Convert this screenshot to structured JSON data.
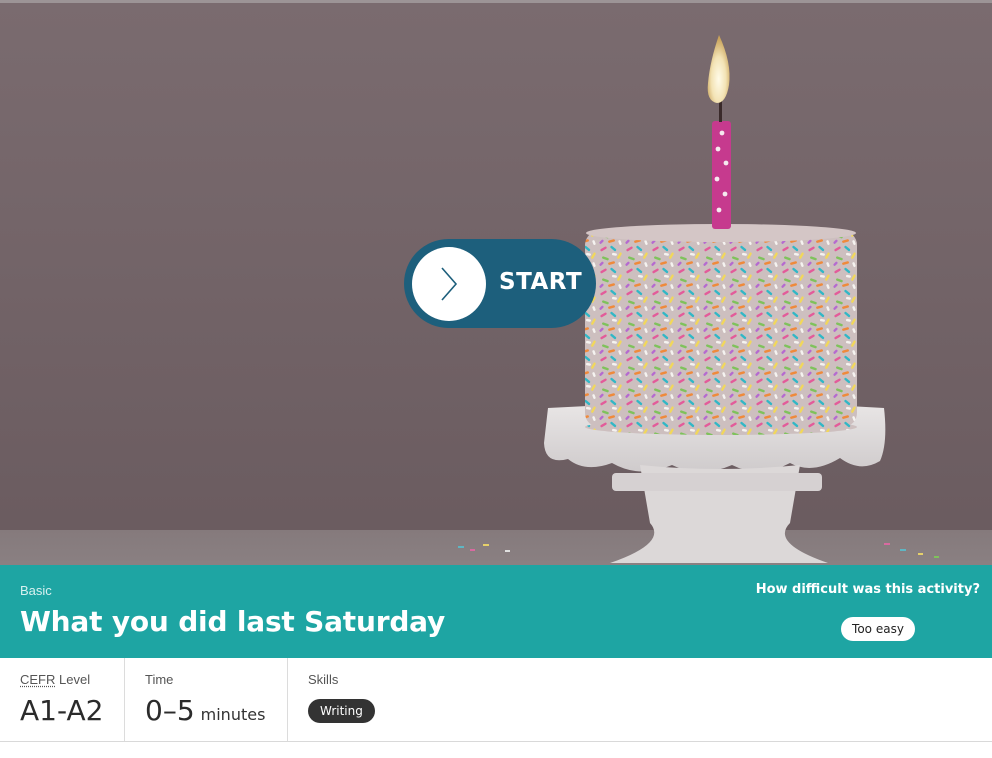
{
  "hero": {
    "start_label": "START",
    "start_icon": "chevron-right-icon"
  },
  "activity": {
    "level": "Basic",
    "title": "What you did last Saturday",
    "difficulty_question": "How difficult was this activity?",
    "difficulty_option": "Too easy"
  },
  "info": {
    "cefr": {
      "label_abbr": "CEFR",
      "label_rest": " Level",
      "value": "A1-A2"
    },
    "time": {
      "label": "Time",
      "value": "0–5",
      "unit": "minutes"
    },
    "skills": {
      "label": "Skills",
      "items": [
        "Writing"
      ]
    }
  },
  "colors": {
    "banner": "#1ea5a3",
    "start_button": "#1d5f7c",
    "skill_pill": "#333333"
  }
}
